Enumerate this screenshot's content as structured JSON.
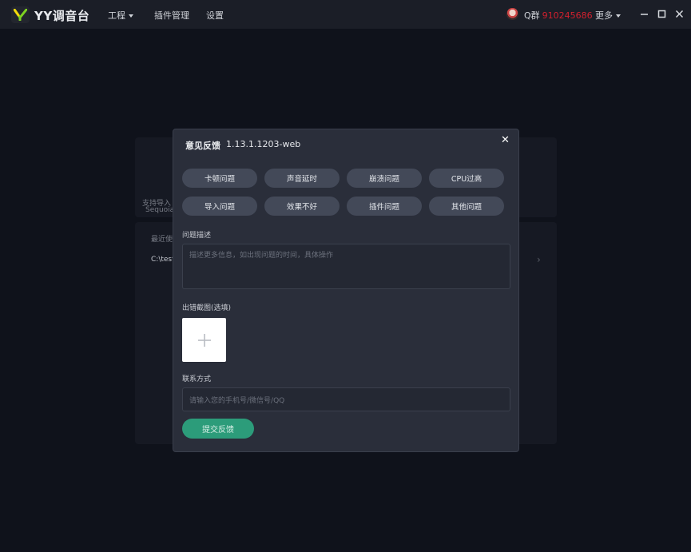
{
  "app": {
    "brand": "YY调音台",
    "menus": {
      "project": "工程",
      "plugins": "插件管理",
      "settings": "设置"
    },
    "qq_label": "Q群",
    "qq_number": "910245686",
    "more": "更多"
  },
  "background": {
    "partial_text_1": "支持导入",
    "partial_text_2": "Sequoia",
    "partial_text_3": "最近使",
    "recent_path": "C:\\test",
    "chevron": "›"
  },
  "modal": {
    "title": "意见反馈",
    "version": "1.13.1.1203-web",
    "close": "✕",
    "tags": [
      "卡顿问题",
      "声音延时",
      "崩溃问题",
      "CPU过高",
      "导入问题",
      "效果不好",
      "插件问题",
      "其他问题"
    ],
    "description_label": "问题描述",
    "description_placeholder": "描述更多信息，如出现问题的时间，具体操作",
    "screenshot_label": "出错截图(选填)",
    "contact_label": "联系方式",
    "contact_placeholder": "请输入您的手机号/微信号/QQ",
    "submit": "提交反馈"
  },
  "colors": {
    "accent": "#2c9c7a",
    "qq_number": "#d2202e",
    "background": "#0f121b",
    "modal": "#2a2e3a"
  }
}
